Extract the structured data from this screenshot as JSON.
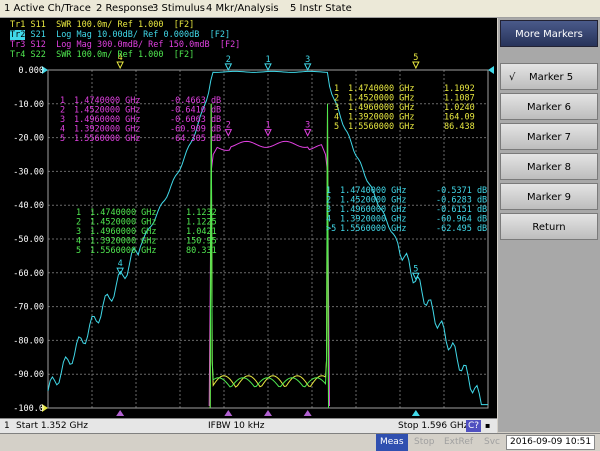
{
  "menu": [
    "1 Active Ch/Trace",
    "2 Response",
    "3 Stimulus",
    "4 Mkr/Analysis",
    "5 Instr State"
  ],
  "traces": [
    {
      "label": "Tr1",
      "text": "S11  SWR 100.0m/ Ref 1.000  [F2]",
      "color": "#e8e840"
    },
    {
      "label": "Tr2",
      "text": "S21  Log Mag 10.00dB/ Ref 0.000dB  [F2]",
      "color": "#40d8e8",
      "active": true
    },
    {
      "label": "Tr3",
      "text": "S12  Log Mag 300.0mdB/ Ref 150.0mdB  [F2]",
      "color": "#e040e0"
    },
    {
      "label": "Tr4",
      "text": "S22  SWR 100.0m/ Ref 1.000  [F2]",
      "color": "#50e850"
    }
  ],
  "y_axis_labels": [
    "0.000",
    "-10.00",
    "-20.00",
    "-30.00",
    "-40.00",
    "-50.00",
    "-60.00",
    "-70.00",
    "-80.00",
    "-90.00",
    "-100.0"
  ],
  "marker_tables": {
    "tr3": {
      "color": "#e040e0",
      "rows": [
        {
          "n": "1",
          "freq": "1.4740000 GHz",
          "val": "-0.4663 dB"
        },
        {
          "n": "2",
          "freq": "1.4520000 GHz",
          "val": "-0.6410 dB"
        },
        {
          "n": "3",
          "freq": "1.4960000 GHz",
          "val": "-0.6063 dB"
        },
        {
          "n": "4",
          "freq": "1.3920000 GHz",
          "val": "-60.909 dB"
        },
        {
          "n": "5",
          "freq": "1.5560000 GHz",
          "val": "-64.305 dB"
        }
      ]
    },
    "tr1": {
      "color": "#e8e840",
      "rows": [
        {
          "n": "1",
          "freq": "1.4740000 GHz",
          "val": "1.1092"
        },
        {
          "n": "2",
          "freq": "1.4520000 GHz",
          "val": "1.1087"
        },
        {
          "n": "3",
          "freq": "1.4960000 GHz",
          "val": "1.0240"
        },
        {
          "n": "4",
          "freq": "1.3920000 GHz",
          "val": "164.09"
        },
        {
          "n": "5",
          "freq": "1.5560000 GHz",
          "val": "86.438"
        }
      ]
    },
    "tr4": {
      "color": "#50e850",
      "rows": [
        {
          "n": "1",
          "freq": "1.4740000 GHz",
          "val": "1.1232"
        },
        {
          "n": "2",
          "freq": "1.4520000 GHz",
          "val": "1.1225"
        },
        {
          "n": "3",
          "freq": "1.4960000 GHz",
          "val": "1.0421"
        },
        {
          "n": "4",
          "freq": "1.3920000 GHz",
          "val": "150.95"
        },
        {
          "n": "5",
          "freq": "1.5560000 GHz",
          "val": "80.331"
        }
      ]
    },
    "tr2": {
      "color": "#40d8e8",
      "rows": [
        {
          "n": "1",
          "freq": "1.4740000 GHz",
          "val": "-0.5371 dB"
        },
        {
          "n": "2",
          "freq": "1.4520000 GHz",
          "val": "-0.6283 dB"
        },
        {
          "n": "3",
          "freq": "1.4960000 GHz",
          "val": "-0.6151 dB"
        },
        {
          "n": "4",
          "freq": "1.3920000 GHz",
          "val": "-60.964 dB"
        },
        {
          "n": ">5",
          "freq": "1.5560000 GHz",
          "val": "-62.495 dB"
        }
      ]
    }
  },
  "softkeys": {
    "title": "More Markers",
    "items": [
      {
        "label": "Marker 5",
        "check": "√"
      },
      {
        "label": "Marker 6"
      },
      {
        "label": "Marker 7"
      },
      {
        "label": "Marker 8"
      },
      {
        "label": "Marker 9"
      }
    ],
    "return": "Return"
  },
  "status": {
    "channel": "1",
    "start": "Start 1.352 GHz",
    "ifbw": "IFBW 10 kHz",
    "stop": "Stop 1.596 GHz",
    "badge": "C?"
  },
  "bottom": {
    "meas": "Meas",
    "stop": "Stop",
    "extref": "ExtRef",
    "svc": "Svc",
    "datetime": "2016-09-09 10:51"
  }
}
